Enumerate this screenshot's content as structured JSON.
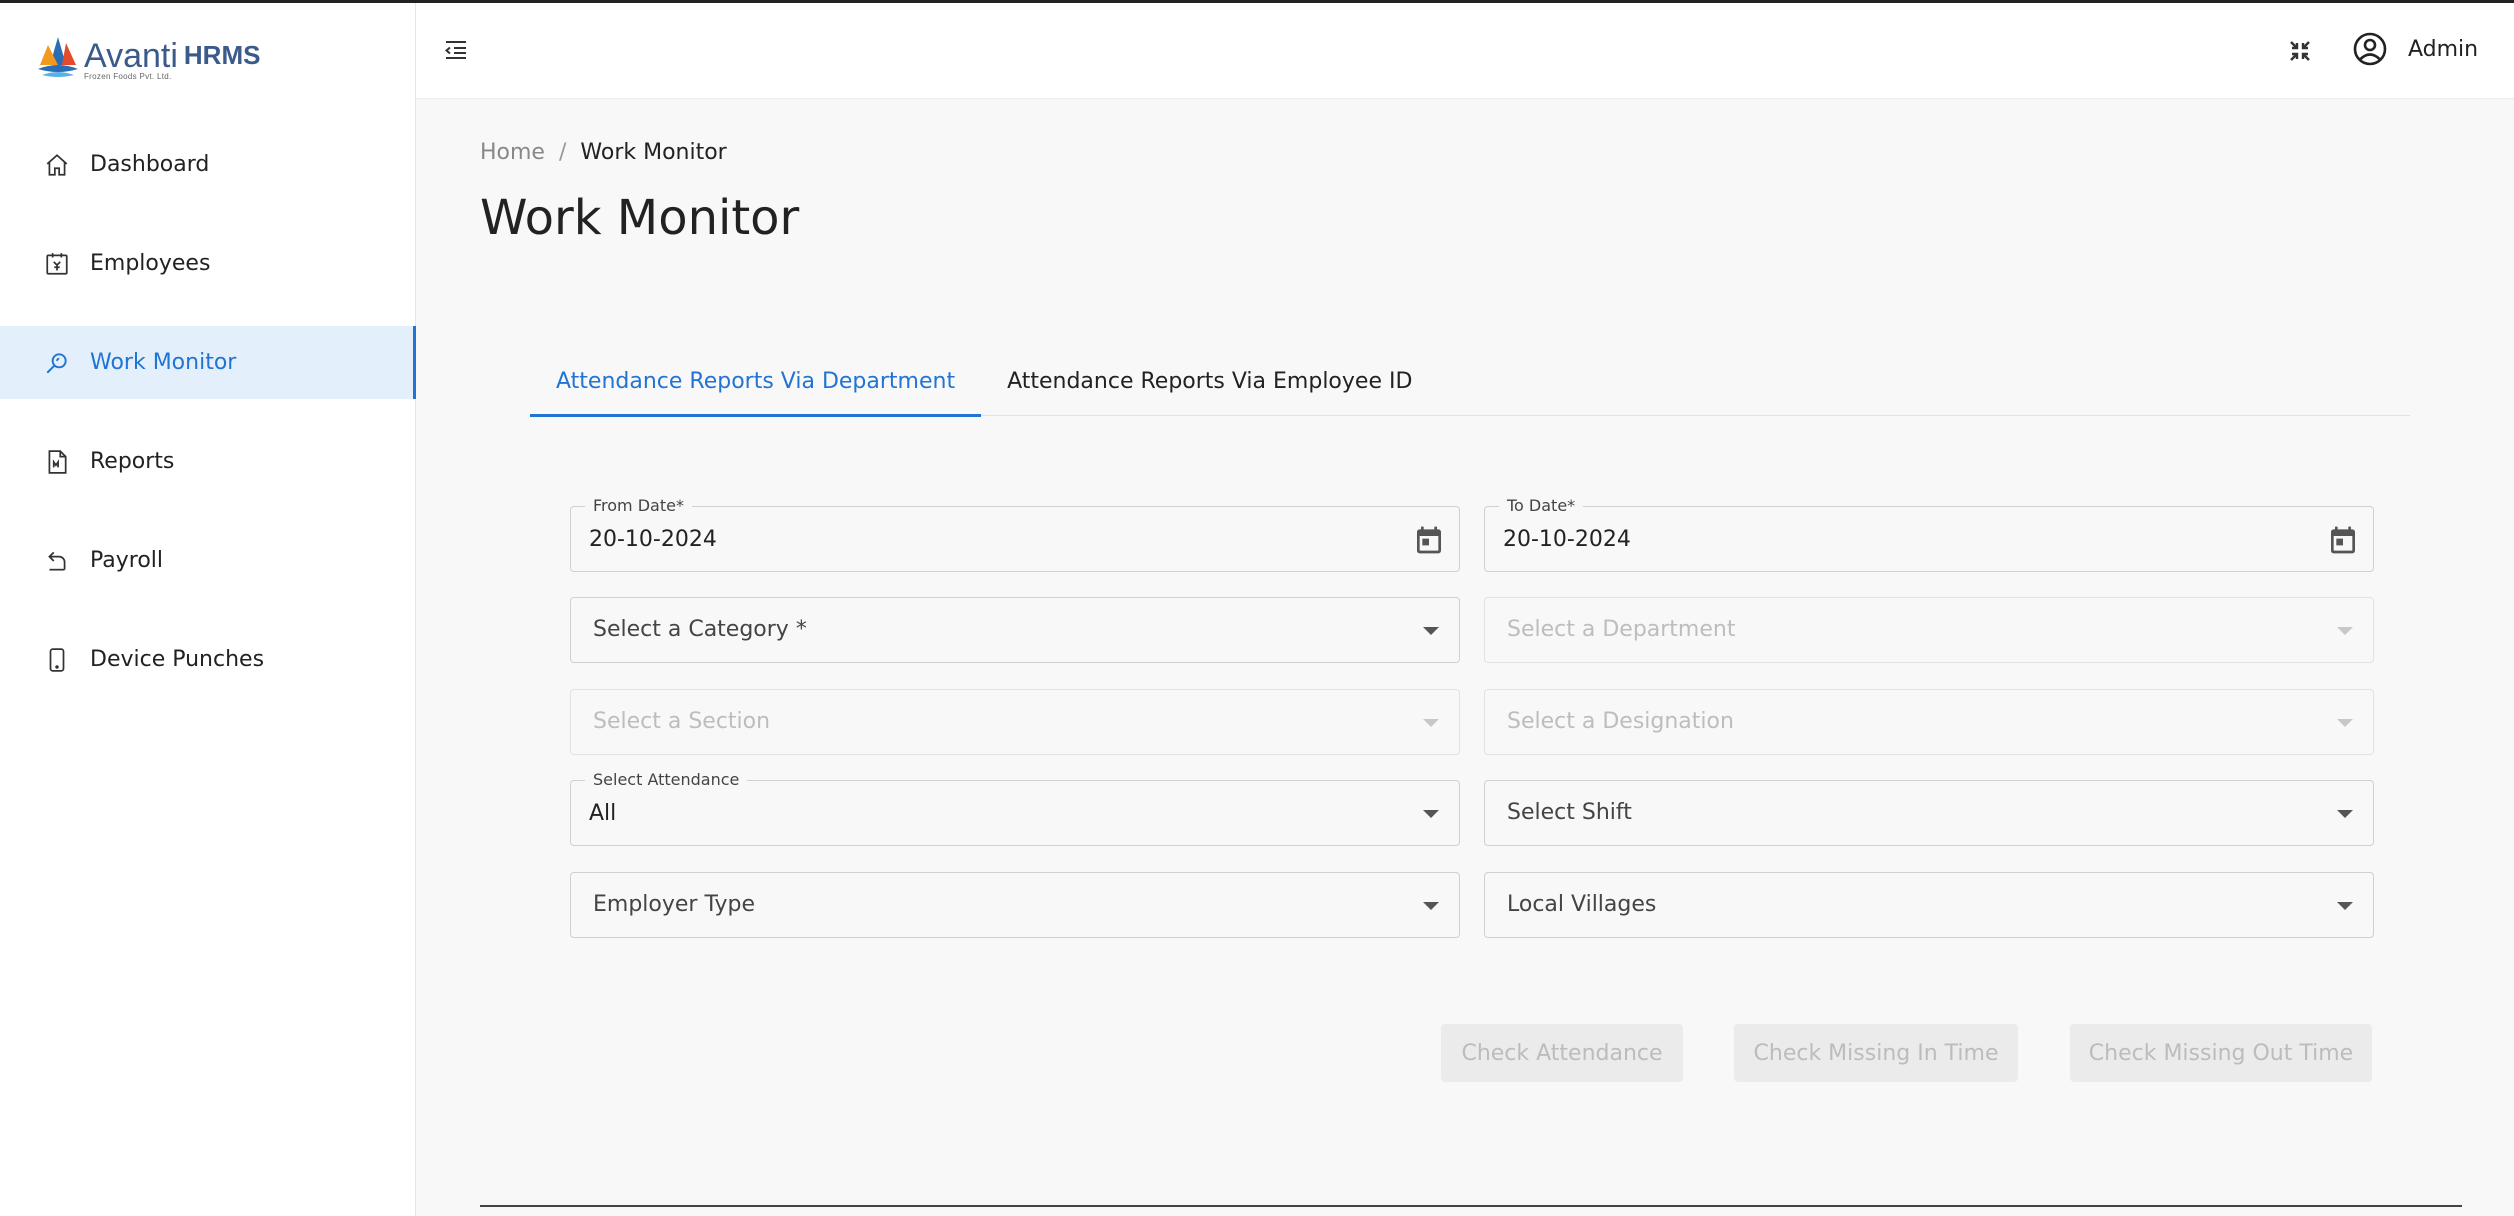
{
  "brand": {
    "name": "Avanti",
    "subtitle": "Frozen Foods Pvt. Ltd.",
    "product": "HRMS"
  },
  "sidebar": {
    "items": [
      {
        "label": "Dashboard",
        "icon": "home-icon",
        "active": false
      },
      {
        "label": "Employees",
        "icon": "employee-badge-icon",
        "active": false
      },
      {
        "label": "Work Monitor",
        "icon": "search-monitor-icon",
        "active": true
      },
      {
        "label": "Reports",
        "icon": "report-document-icon",
        "active": false
      },
      {
        "label": "Payroll",
        "icon": "payroll-return-icon",
        "active": false
      },
      {
        "label": "Device Punches",
        "icon": "mobile-device-icon",
        "active": false
      }
    ]
  },
  "header": {
    "user_name": "Admin"
  },
  "breadcrumb": {
    "home": "Home",
    "separator": "/",
    "current": "Work Monitor"
  },
  "page_title": "Work Monitor",
  "tabs": [
    {
      "label": "Attendance Reports Via Department",
      "active": true
    },
    {
      "label": "Attendance Reports Via Employee ID",
      "active": false
    }
  ],
  "form": {
    "from_date": {
      "label": "From Date*",
      "value": "20-10-2024"
    },
    "to_date": {
      "label": "To Date*",
      "value": "20-10-2024"
    },
    "category": {
      "placeholder": "Select a Category *"
    },
    "department": {
      "placeholder": "Select a Department"
    },
    "section": {
      "placeholder": "Select a Section"
    },
    "designation": {
      "placeholder": "Select a Designation"
    },
    "attendance": {
      "label": "Select Attendance",
      "value": "All"
    },
    "shift": {
      "placeholder": "Select Shift"
    },
    "employer_type": {
      "placeholder": "Employer Type"
    },
    "local_villages": {
      "placeholder": "Local Villages"
    }
  },
  "buttons": {
    "check_attendance": "Check Attendance",
    "check_missing_in": "Check Missing In Time",
    "check_missing_out": "Check Missing Out Time"
  },
  "colors": {
    "accent": "#2174d3",
    "active_bg": "#e3f0fc",
    "brand": "#3a5a8c"
  }
}
